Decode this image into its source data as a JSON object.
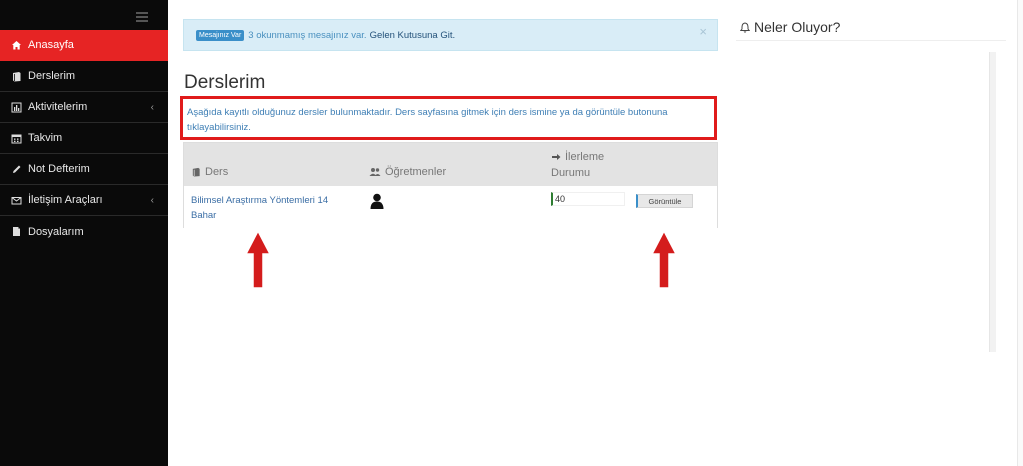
{
  "sidebar": {
    "items": [
      {
        "label": "Anasayfa",
        "icon": "home-icon",
        "active": true
      },
      {
        "label": "Derslerim",
        "icon": "book-icon"
      },
      {
        "label": "Aktivitelerim",
        "icon": "chart-icon",
        "chevron": "‹"
      },
      {
        "label": "Takvim",
        "icon": "calendar-icon"
      },
      {
        "label": "Not Defterim",
        "icon": "pencil-icon"
      },
      {
        "label": "İletişim Araçları",
        "icon": "envelope-icon",
        "chevron": "‹"
      },
      {
        "label": "Dosyalarım",
        "icon": "file-icon"
      }
    ]
  },
  "alert": {
    "badge": "Mesajınız Var",
    "message": "3 okunmamış mesajınız var.",
    "link": "Gelen Kutusuna Git.",
    "close": "×"
  },
  "page": {
    "title": "Derslerim",
    "info": "Aşağıda kayıtlı olduğunuz dersler bulunmaktadır. Ders sayfasına gitmek için ders ismine ya da görüntüle butonuna tıklayabilirsiniz."
  },
  "table": {
    "headers": {
      "course": "Ders",
      "teachers": "Öğretmenler",
      "progress_line1": "İlerleme",
      "progress_line2": "Durumu"
    },
    "rows": [
      {
        "course": "Bilimsel Araştırma Yöntemleri 14 Bahar",
        "progress": "40",
        "button": "Görüntüle"
      }
    ]
  },
  "right_panel": {
    "title": "Neler Oluyor?"
  },
  "colors": {
    "sidebar_bg": "#0a0a0a",
    "active_item": "#e62424",
    "highlight_border": "#e01b1b",
    "arrow": "#d41c1c"
  }
}
